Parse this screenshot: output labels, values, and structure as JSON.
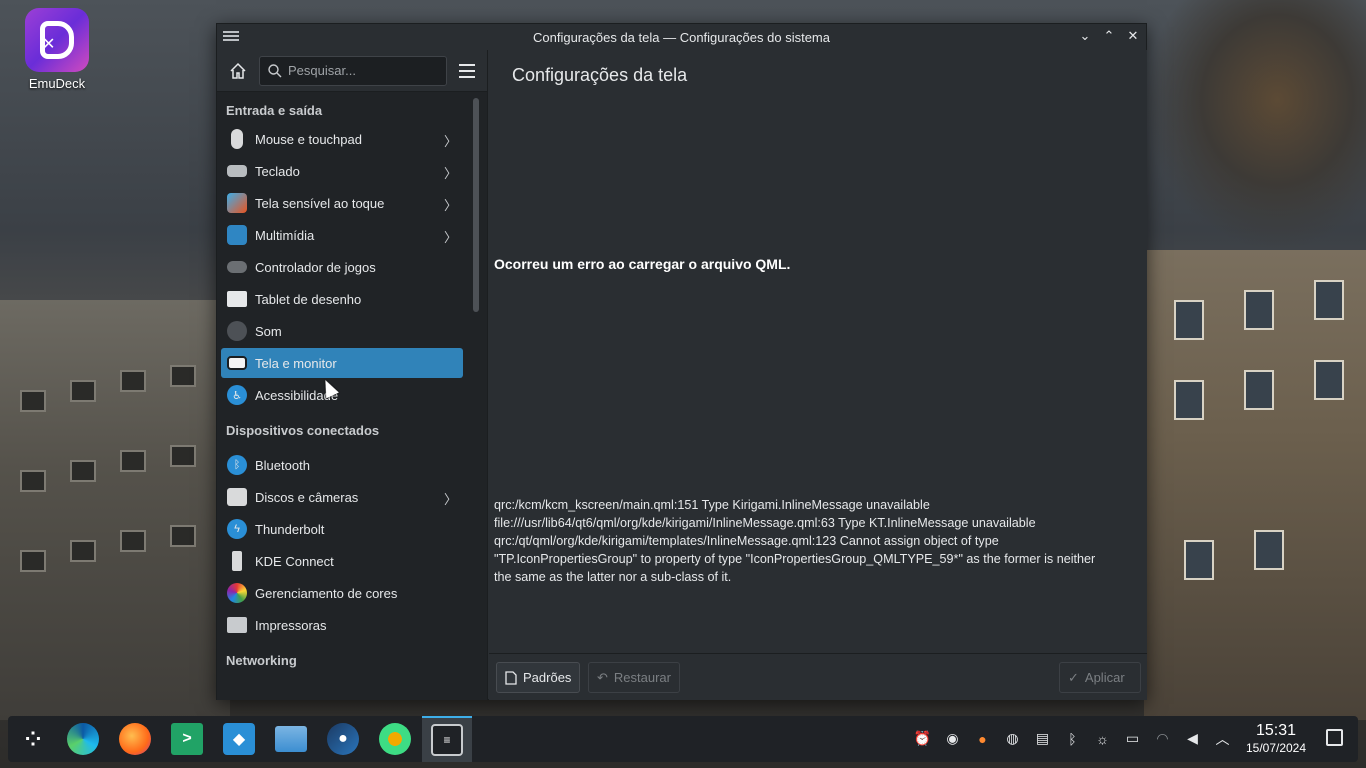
{
  "desktop": {
    "icons": [
      {
        "label": "EmuDeck",
        "icon": "emudeck-icon"
      }
    ]
  },
  "window": {
    "title": "Configurações da tela — Configurações do sistema",
    "controls": [
      "minimize",
      "maximize",
      "close"
    ]
  },
  "sidebar": {
    "search_placeholder": "Pesquisar...",
    "sections": [
      {
        "title": "Entrada e saída",
        "items": [
          {
            "label": "Mouse e touchpad",
            "icon": "mouse-icon",
            "has_children": true
          },
          {
            "label": "Teclado",
            "icon": "keyboard-icon",
            "has_children": true
          },
          {
            "label": "Tela sensível ao toque",
            "icon": "touchscreen-icon",
            "has_children": true
          },
          {
            "label": "Multimídia",
            "icon": "multimedia-icon",
            "has_children": true
          },
          {
            "label": "Controlador de jogos",
            "icon": "gamepad-icon",
            "has_children": false
          },
          {
            "label": "Tablet de desenho",
            "icon": "tablet-icon",
            "has_children": false
          },
          {
            "label": "Som",
            "icon": "speaker-icon",
            "has_children": false
          },
          {
            "label": "Tela e monitor",
            "icon": "monitor-icon",
            "has_children": false,
            "active": true
          },
          {
            "label": "Acessibilidade",
            "icon": "accessibility-icon",
            "has_children": false
          }
        ]
      },
      {
        "title": "Dispositivos conectados",
        "items": [
          {
            "label": "Bluetooth",
            "icon": "bluetooth-icon",
            "has_children": false
          },
          {
            "label": "Discos e câmeras",
            "icon": "disk-icon",
            "has_children": true
          },
          {
            "label": "Thunderbolt",
            "icon": "thunderbolt-icon",
            "has_children": false
          },
          {
            "label": "KDE Connect",
            "icon": "kde-connect-icon",
            "has_children": false
          },
          {
            "label": "Gerenciamento de cores",
            "icon": "color-management-icon",
            "has_children": false
          },
          {
            "label": "Impressoras",
            "icon": "printer-icon",
            "has_children": false
          }
        ]
      },
      {
        "title": "Networking",
        "items": []
      }
    ]
  },
  "main": {
    "title": "Configurações da tela",
    "error_title": "Ocorreu um erro ao carregar o arquivo QML.",
    "error_lines": [
      "qrc:/kcm/kcm_kscreen/main.qml:151 Type Kirigami.InlineMessage unavailable",
      "file:///usr/lib64/qt6/qml/org/kde/kirigami/InlineMessage.qml:63 Type KT.InlineMessage unavailable",
      "qrc:/qt/qml/org/kde/kirigami/templates/InlineMessage.qml:123 Cannot assign object of type \"TP.IconPropertiesGroup\" to property of type \"IconPropertiesGroup_QMLTYPE_59*\" as the former is neither the same as the latter nor a sub-class of it."
    ],
    "footer": {
      "defaults_label": "Padrões",
      "reset_label": "Restaurar",
      "apply_label": "Aplicar"
    }
  },
  "taskbar": {
    "apps": [
      {
        "name": "application-launcher",
        "icon": "launcher-icon"
      },
      {
        "name": "edge",
        "icon": "edge-icon"
      },
      {
        "name": "firefox",
        "icon": "firefox-icon"
      },
      {
        "name": "excel",
        "icon": "excel-icon"
      },
      {
        "name": "discover",
        "icon": "discover-icon"
      },
      {
        "name": "dolphin",
        "icon": "folder-icon"
      },
      {
        "name": "steam",
        "icon": "steam-icon"
      },
      {
        "name": "emulator",
        "icon": "android-icon"
      },
      {
        "name": "system-settings",
        "icon": "settings-icon",
        "active": true
      }
    ],
    "tray": [
      "notifications-icon",
      "discord-icon",
      "firefox-tray-icon",
      "steam-tray-icon",
      "clipboard-icon",
      "bluetooth-tray-icon",
      "brightness-icon",
      "battery-icon",
      "wifi-icon",
      "volume-icon",
      "expand-tray-icon"
    ],
    "time": "15:31",
    "date": "15/07/2024"
  },
  "colors": {
    "accent": "#3083b9",
    "window_bg": "#2a2e32",
    "sidebar_bg": "#202326"
  }
}
